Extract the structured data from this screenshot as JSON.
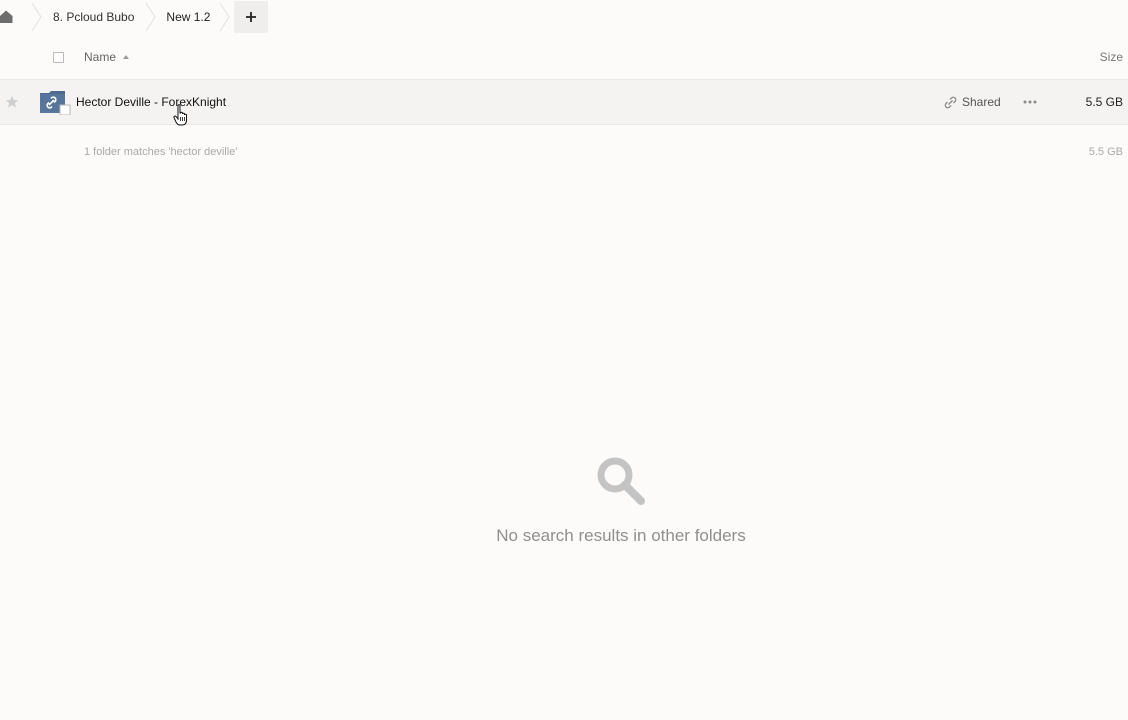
{
  "breadcrumb": {
    "items": [
      {
        "label": "8. Pcloud Bubo"
      },
      {
        "label": "New 1.2"
      }
    ],
    "add_label": "+"
  },
  "header": {
    "name_label": "Name",
    "size_label": "Size"
  },
  "files": [
    {
      "name": "Hector Deville - ForexKnight",
      "shared_label": "Shared",
      "size": "5.5 GB",
      "icon": "shared-folder-icon"
    }
  ],
  "summary": {
    "text": "1 folder matches 'hector deville'",
    "size": "5.5 GB"
  },
  "empty_state": {
    "message": "No search results in other folders",
    "icon": "search-icon"
  },
  "colors": {
    "background": "#fcfbfa",
    "row_highlight": "#f4f3f2",
    "folder_blue": "#4f6b8f"
  }
}
